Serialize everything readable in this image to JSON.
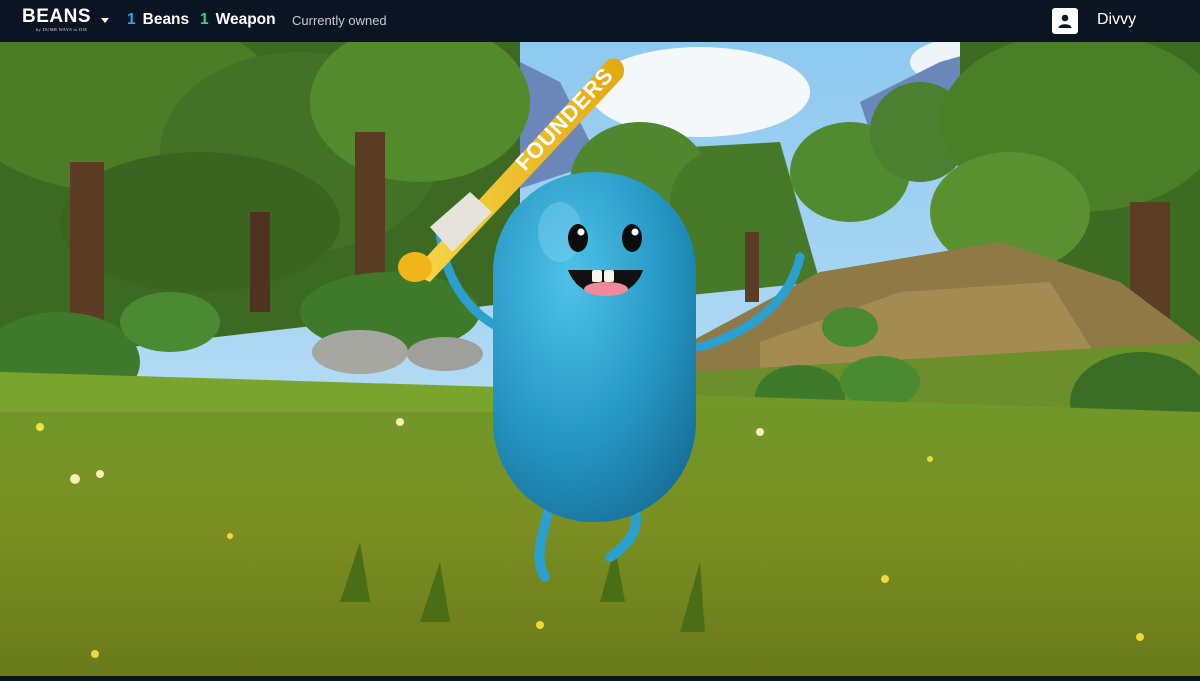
{
  "header": {
    "logo_text": "BEANS",
    "logo_subtext": "by DUMB WAYS to DIE",
    "beans_count": "1",
    "beans_label": "Beans",
    "weapon_count": "1",
    "weapon_label": "Weapon",
    "owned_label": "Currently owned",
    "username": "Divvy",
    "beans_color": "#2fa8e6",
    "weapon_color": "#3fcf7a"
  },
  "scene": {
    "bat_text": "FOUNDERS",
    "character_color": "#2596c3",
    "bat_color": "#f3c21c"
  },
  "icons": {
    "dropdown": "chevron-down-icon",
    "avatar": "user-icon"
  }
}
